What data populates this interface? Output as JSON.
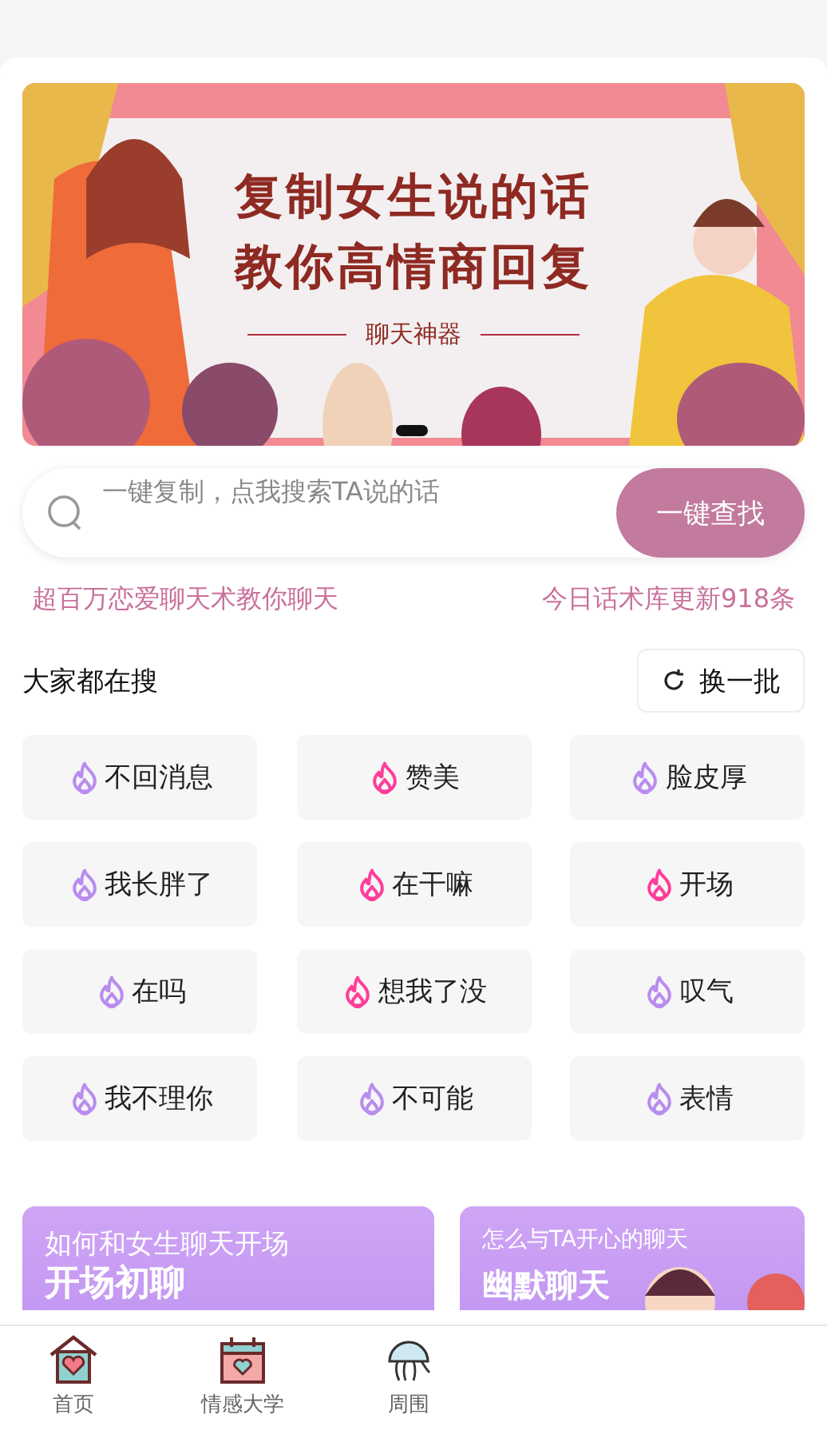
{
  "banner": {
    "line_1": "复制女生说的话",
    "line_2": "教你高情商回复",
    "subtitle": "聊天神器"
  },
  "search": {
    "placeholder": "一键复制，点我搜索TA说的话",
    "button": "一键查找"
  },
  "taglines": [
    "超百万恋爱聊天术教你聊天",
    "今日话术库更新918条"
  ],
  "trending": {
    "title": "大家都在搜",
    "refresh": "换一批",
    "tags": [
      {
        "label": "不回消息",
        "color": "#b98cf0"
      },
      {
        "label": "赞美",
        "color": "#ff3e9a"
      },
      {
        "label": "脸皮厚",
        "color": "#b98cf0"
      },
      {
        "label": "我长胖了",
        "color": "#b98cf0"
      },
      {
        "label": "在干嘛",
        "color": "#ff3e9a"
      },
      {
        "label": "开场",
        "color": "#ff3e9a"
      },
      {
        "label": "在吗",
        "color": "#b98cf0"
      },
      {
        "label": "想我了没",
        "color": "#ff3e9a"
      },
      {
        "label": "叹气",
        "color": "#b98cf0"
      },
      {
        "label": "我不理你",
        "color": "#b98cf0"
      },
      {
        "label": "不可能",
        "color": "#b98cf0"
      },
      {
        "label": "表情",
        "color": "#b98cf0"
      }
    ]
  },
  "cards": [
    {
      "subtitle": "如何和女生聊天开场",
      "title": "开场初聊"
    },
    {
      "subtitle": "怎么与TA开心的聊天",
      "title": "幽默聊天"
    }
  ],
  "nav": [
    {
      "label": "首页"
    },
    {
      "label": "情感大学"
    },
    {
      "label": "周围"
    }
  ]
}
